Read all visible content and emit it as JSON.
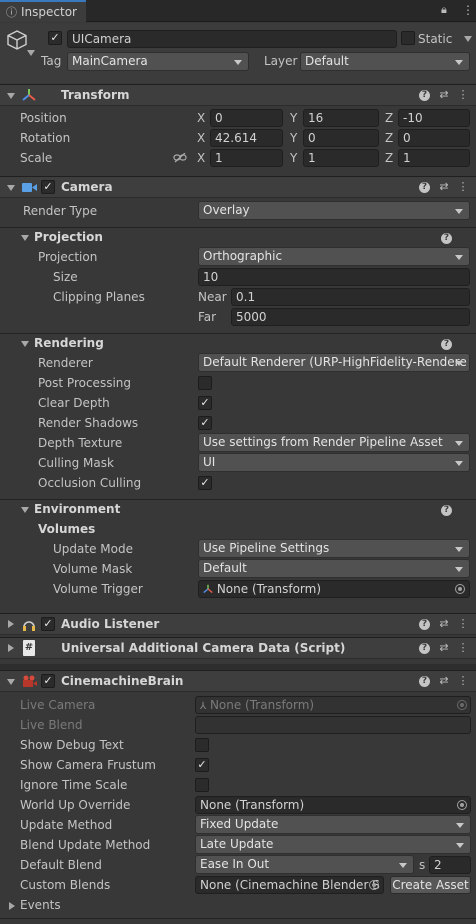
{
  "window": {
    "tab_label": "Inspector"
  },
  "object": {
    "name": "UICamera",
    "static_label": "Static",
    "tag_label": "Tag",
    "tag_value": "MainCamera",
    "layer_label": "Layer",
    "layer_value": "Default"
  },
  "transform": {
    "title": "Transform",
    "rows": [
      {
        "label": "Position",
        "x": "0",
        "y": "16",
        "z": "-10"
      },
      {
        "label": "Rotation",
        "x": "42.614",
        "y": "0",
        "z": "0"
      },
      {
        "label": "Scale",
        "x": "1",
        "y": "1",
        "z": "1"
      }
    ],
    "axis": {
      "x": "X",
      "y": "Y",
      "z": "Z"
    }
  },
  "camera": {
    "title": "Camera",
    "render_type_label": "Render Type",
    "render_type_value": "Overlay",
    "projection_section": "Projection",
    "projection_label": "Projection",
    "projection_value": "Orthographic",
    "size_label": "Size",
    "size_value": "10",
    "clipping_label": "Clipping Planes",
    "near_label": "Near",
    "near_value": "0.1",
    "far_label": "Far",
    "far_value": "5000",
    "rendering_section": "Rendering",
    "renderer_label": "Renderer",
    "renderer_value": "Default Renderer (URP-HighFidelity-Rendere",
    "post_processing_label": "Post Processing",
    "post_processing": false,
    "clear_depth_label": "Clear Depth",
    "clear_depth": true,
    "render_shadows_label": "Render Shadows",
    "render_shadows": true,
    "depth_texture_label": "Depth Texture",
    "depth_texture_value": "Use settings from Render Pipeline Asset",
    "culling_mask_label": "Culling Mask",
    "culling_mask_value": "UI",
    "occlusion_label": "Occlusion Culling",
    "occlusion": true,
    "environment_section": "Environment",
    "volumes_label": "Volumes",
    "update_mode_label": "Update Mode",
    "update_mode_value": "Use Pipeline Settings",
    "volume_mask_label": "Volume Mask",
    "volume_mask_value": "Default",
    "volume_trigger_label": "Volume Trigger",
    "volume_trigger_value": "None (Transform)"
  },
  "audio_listener": {
    "title": "Audio Listener"
  },
  "additional_data": {
    "title": "Universal Additional Camera Data (Script)"
  },
  "brain": {
    "title": "CinemachineBrain",
    "live_camera_label": "Live Camera",
    "live_camera_value": "None (Transform)",
    "live_blend_label": "Live Blend",
    "live_blend_value": "",
    "show_debug_label": "Show Debug Text",
    "show_debug": false,
    "show_frustum_label": "Show Camera Frustum",
    "show_frustum": true,
    "ignore_time_label": "Ignore Time Scale",
    "ignore_time": false,
    "world_up_label": "World Up Override",
    "world_up_value": "None (Transform)",
    "update_method_label": "Update Method",
    "update_method_value": "Fixed Update",
    "blend_update_label": "Blend Update Method",
    "blend_update_value": "Late Update",
    "default_blend_label": "Default Blend",
    "default_blend_value": "Ease In Out",
    "default_blend_s": "s",
    "default_blend_time": "2",
    "custom_blends_label": "Custom Blends",
    "custom_blends_value": "None (Cinemachine Blender S",
    "create_asset_label": "Create Asset",
    "events_label": "Events"
  },
  "icons": {
    "help": "?",
    "settings": "⇄",
    "more": "⋮"
  }
}
